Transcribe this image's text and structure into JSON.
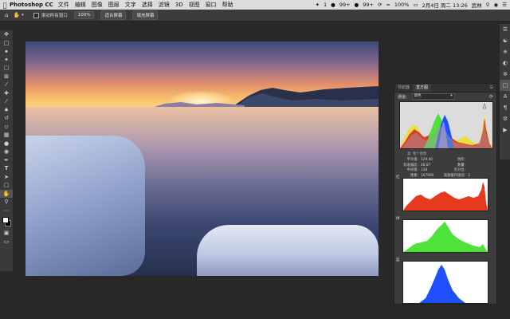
{
  "menubar": {
    "apple": "",
    "app": "Photoshop CC",
    "items": [
      "文件",
      "编辑",
      "图像",
      "图层",
      "文字",
      "选择",
      "滤镜",
      "3D",
      "视图",
      "窗口",
      "帮助"
    ],
    "status": {
      "wechat_count": "1",
      "qq_label": "99+",
      "mail_label": "99+",
      "battery": "100%",
      "date_time": "2月4日 周二 13:26",
      "user": "武林"
    }
  },
  "options": {
    "scroll_all_label": "滚动所有窗口",
    "zoom_label": "100%",
    "fit_screen_label": "适合屏幕",
    "fill_screen_label": "填充屏幕"
  },
  "histogram": {
    "tabs": [
      "导航器",
      "直方图"
    ],
    "active_tab": "直方图",
    "channel_label": "通道:",
    "channel_value": "颜色",
    "source_label": "源: 整个图像",
    "stats": {
      "mean_label": "平均值:",
      "mean": "129.40",
      "std_label": "标准偏差:",
      "std": "48.87",
      "median_label": "中间值:",
      "median": "128",
      "pixels_label": "像素:",
      "pixels": "167000",
      "level_label": "色阶:",
      "level": "",
      "count_label": "数量:",
      "count": "",
      "percentile_label": "百分位:",
      "percentile": "",
      "cache_label": "高速缓存级别:",
      "cache": "3"
    },
    "channels": [
      "红",
      "绿",
      "蓝"
    ],
    "colors": {
      "red": "#e63a1e",
      "green": "#4ee23a",
      "blue": "#1f4fff"
    }
  }
}
